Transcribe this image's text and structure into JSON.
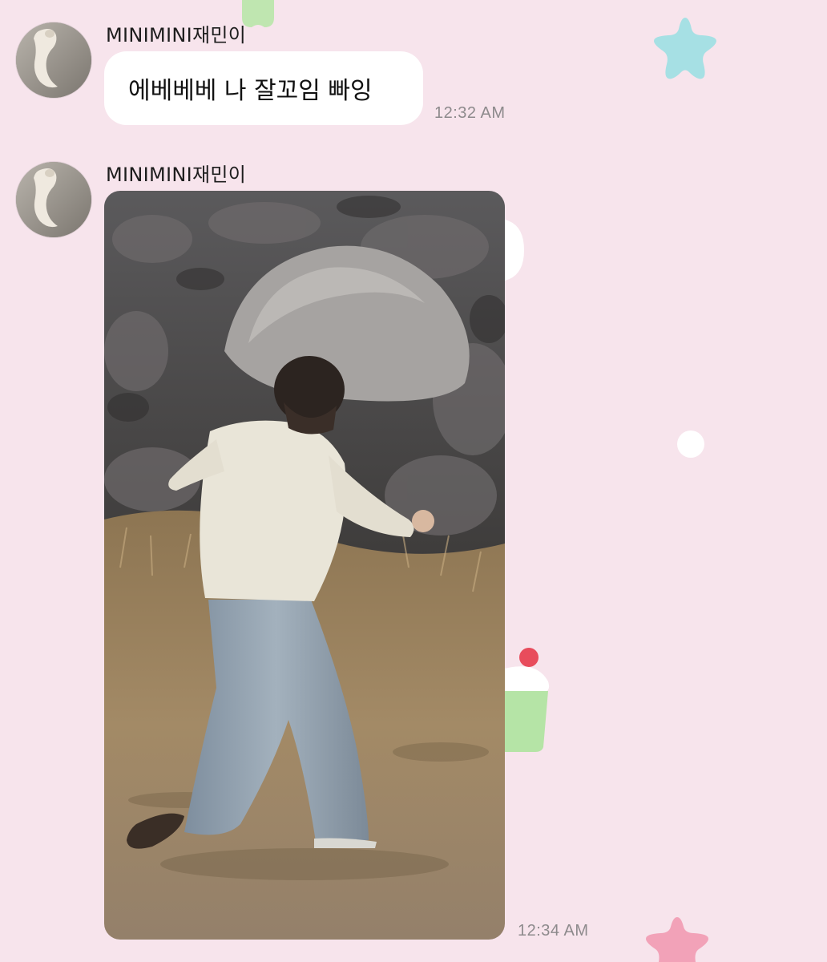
{
  "messages": [
    {
      "sender": "MINIMINI재민이",
      "text": "에베베베 나 잘꼬임 빠잉",
      "time": "12:32 AM"
    },
    {
      "sender": "MINIMINI재민이",
      "attachment": "photo",
      "time": "12:34 AM"
    }
  ],
  "colors": {
    "background": "#f7e4ec",
    "bubble": "#ffffff",
    "timestamp": "#8d8a8c"
  },
  "icons": [
    "star-sticker-icon",
    "cupcake-sticker-icon",
    "dot-icon"
  ]
}
